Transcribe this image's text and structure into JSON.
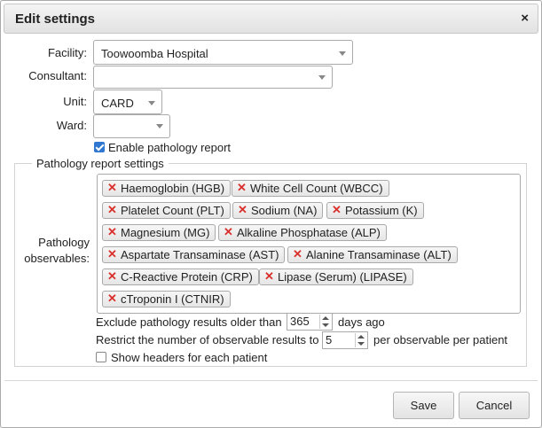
{
  "dialog": {
    "title": "Edit settings",
    "close_glyph": "×"
  },
  "form": {
    "facility_label": "Facility:",
    "facility_value": "Toowoomba Hospital",
    "consultant_label": "Consultant:",
    "consultant_value": "",
    "unit_label": "Unit:",
    "unit_value": "CARD",
    "ward_label": "Ward:",
    "ward_value": "",
    "enable_pathology_label": "Enable pathology report",
    "enable_pathology_checked": true
  },
  "pathology": {
    "legend": "Pathology report settings",
    "observables_label_line1": "Pathology",
    "observables_label_line2": "observables:",
    "remove_glyph": "✕",
    "tags": [
      "Haemoglobin (HGB)",
      "White Cell Count (WBCC)",
      "Platelet Count (PLT)",
      "Sodium (NA)",
      "Potassium (K)",
      "Magnesium (MG)",
      "Alkaline Phosphatase (ALP)",
      "Aspartate Transaminase (AST)",
      "Alanine Transaminase (ALT)",
      "C-Reactive Protein (CRP)",
      "Lipase (Serum) (LIPASE)",
      "cTroponin I (CTNIR)"
    ],
    "exclude_prefix": "Exclude pathology results older than",
    "exclude_value": "365",
    "exclude_suffix": "days ago",
    "restrict_prefix": "Restrict the number of observable results to",
    "restrict_value": "5",
    "restrict_suffix": "per observable per patient",
    "show_headers_label": "Show headers for each patient",
    "show_headers_checked": false
  },
  "buttons": {
    "save": "Save",
    "cancel": "Cancel"
  },
  "colors": {
    "remove_x": "#d9302b",
    "checkbox_on": "#2f77d0"
  }
}
